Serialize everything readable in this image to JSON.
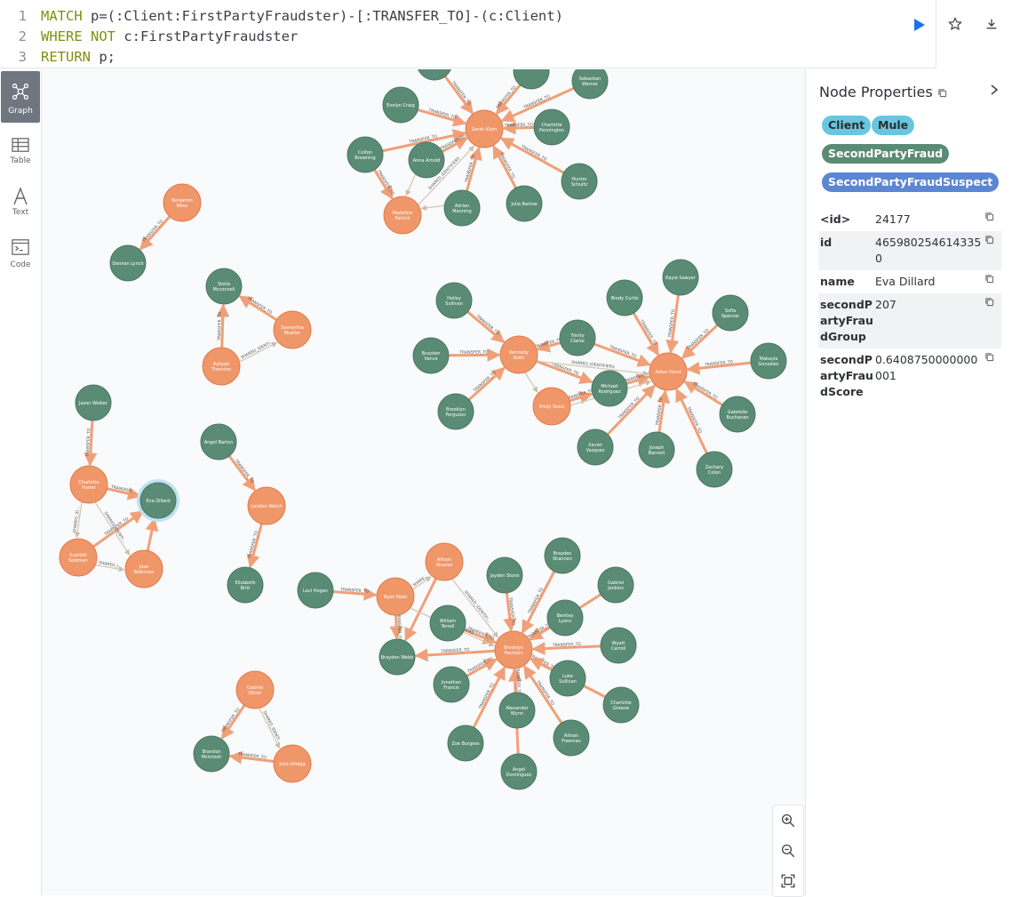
{
  "editor": {
    "lines": [
      {
        "num": "1",
        "parts": [
          {
            "t": "kw",
            "v": "MATCH"
          },
          {
            "t": "tx",
            "v": " p=(:Client:FirstPartyFraudster)-[:TRANSFER_TO]-(c:Client)"
          }
        ]
      },
      {
        "num": "2",
        "parts": [
          {
            "t": "kw",
            "v": "WHERE NOT"
          },
          {
            "t": "tx",
            "v": " c:FirstPartyFraudster"
          }
        ]
      },
      {
        "num": "3",
        "parts": [
          {
            "t": "kw",
            "v": "RETURN"
          },
          {
            "t": "tx",
            "v": " p;"
          }
        ]
      }
    ]
  },
  "toolbar_icons": [
    "play-icon",
    "star-icon",
    "download-icon"
  ],
  "sidebar": {
    "items": [
      {
        "label": "Graph",
        "icon": "graph-icon",
        "active": true
      },
      {
        "label": "Table",
        "icon": "table-icon",
        "active": false
      },
      {
        "label": "Text",
        "icon": "text-icon",
        "active": false
      },
      {
        "label": "Code",
        "icon": "code-icon",
        "active": false
      }
    ]
  },
  "panel": {
    "title": "Node Properties",
    "labels": [
      "Client",
      "Mule",
      "SecondPartyFraud",
      "SecondPartyFraudSuspect"
    ],
    "properties": [
      {
        "key": "<id>",
        "value": "24177"
      },
      {
        "key": "id",
        "value": "4659802546143350"
      },
      {
        "key": "name",
        "value": "Eva Dillard"
      },
      {
        "key": "secondPartyFraudGroup",
        "value": "207"
      },
      {
        "key": "secondPartyFraudScore",
        "value": "0.6408750000000001"
      }
    ]
  },
  "colors": {
    "fraudster": "#f0976a",
    "client": "#5a8c75",
    "edge": "#f0a078",
    "shared": "#d6c7b5"
  },
  "graph": {
    "nodes": [
      {
        "id": "sarah",
        "name": "Sarah Klein",
        "type": "f"
      },
      {
        "id": "madeline",
        "name": "Madeline Patrick",
        "type": "f"
      },
      {
        "id": "evelyn",
        "name": "Evelyn Craig",
        "type": "c"
      },
      {
        "id": "colton",
        "name": "Colton Browning",
        "type": "c"
      },
      {
        "id": "anna",
        "name": "Anna Arnold",
        "type": "c"
      },
      {
        "id": "adrian",
        "name": "Adrian Manning",
        "type": "c"
      },
      {
        "id": "juliab",
        "name": "Julia Barlow",
        "type": "c"
      },
      {
        "id": "hunter",
        "name": "Hunter Schultz",
        "type": "c"
      },
      {
        "id": "charlottep",
        "name": "Charlotte Pennington",
        "type": "c"
      },
      {
        "id": "sebastian",
        "name": "Sebastian Warner",
        "type": "c"
      },
      {
        "id": "top1",
        "name": "",
        "type": "c"
      },
      {
        "id": "top2",
        "name": "",
        "type": "c"
      },
      {
        "id": "benjamin",
        "name": "Benjamin Moss",
        "type": "f"
      },
      {
        "id": "damian",
        "name": "Damian Lynch",
        "type": "c"
      },
      {
        "id": "stella",
        "name": "Stella Mcconnell",
        "type": "c"
      },
      {
        "id": "samantha",
        "name": "Samantha Mueller",
        "type": "f"
      },
      {
        "id": "aaliyah",
        "name": "Aaliyah Thornton",
        "type": "f"
      },
      {
        "id": "jason",
        "name": "Jason Walker",
        "type": "c"
      },
      {
        "id": "charlottef",
        "name": "Charlotte Foster",
        "type": "f"
      },
      {
        "id": "eva",
        "name": "Eva Dillard",
        "type": "c",
        "selected": true
      },
      {
        "id": "scarlett",
        "name": "Scarlett Solomon",
        "type": "f"
      },
      {
        "id": "jose",
        "name": "Jose Robinson",
        "type": "f"
      },
      {
        "id": "angel",
        "name": "Angel Barton",
        "type": "c"
      },
      {
        "id": "landon",
        "name": "Landon Welch",
        "type": "f"
      },
      {
        "id": "elizabeth",
        "name": "Elizabeth Britt",
        "type": "c"
      },
      {
        "id": "gabriel",
        "name": "Gabriel Oliver",
        "type": "f"
      },
      {
        "id": "brandon",
        "name": "Brandon Mcintosh",
        "type": "c"
      },
      {
        "id": "juliao",
        "name": "Julia Ortega",
        "type": "f"
      },
      {
        "id": "hailey",
        "name": "Hailey Sullivan",
        "type": "c"
      },
      {
        "id": "brayden",
        "name": "Brayden Vance",
        "type": "c"
      },
      {
        "id": "kennedy",
        "name": "Kennedy Keith",
        "type": "f"
      },
      {
        "id": "brooklynf",
        "name": "Brooklyn Ferguson",
        "type": "c"
      },
      {
        "id": "trinity",
        "name": "Trinity Clarke",
        "type": "c"
      },
      {
        "id": "brody",
        "name": "Brody Curtis",
        "type": "c"
      },
      {
        "id": "kayla",
        "name": "Kayla Sawyer",
        "type": "c"
      },
      {
        "id": "sofia",
        "name": "Sofia Spencer",
        "type": "c"
      },
      {
        "id": "makayla",
        "name": "Makayla Gonzalez",
        "type": "c"
      },
      {
        "id": "aiden",
        "name": "Aiden Hurst",
        "type": "f"
      },
      {
        "id": "michael",
        "name": "Michael Rodriguez",
        "type": "c"
      },
      {
        "id": "emily",
        "name": "Emily Stout",
        "type": "f"
      },
      {
        "id": "gabriella",
        "name": "Gabriella Buchanan",
        "type": "c"
      },
      {
        "id": "xavier",
        "name": "Xavier Vasquez",
        "type": "c"
      },
      {
        "id": "joseph",
        "name": "Joseph Barnett",
        "type": "c"
      },
      {
        "id": "zachary",
        "name": "Zachary Colon",
        "type": "c"
      },
      {
        "id": "levi",
        "name": "Levi Hogan",
        "type": "c"
      },
      {
        "id": "ryan",
        "name": "Ryan Patel",
        "type": "f"
      },
      {
        "id": "allison",
        "name": "Allison Alvarez",
        "type": "f"
      },
      {
        "id": "william",
        "name": "William Terrell",
        "type": "c"
      },
      {
        "id": "braydenw",
        "name": "Brayden Webb",
        "type": "c"
      },
      {
        "id": "jayden",
        "name": "Jayden Stone",
        "type": "c"
      },
      {
        "id": "braydens",
        "name": "Brayden Shannon",
        "type": "c"
      },
      {
        "id": "gabrielj",
        "name": "Gabriel Jenkins",
        "type": "c"
      },
      {
        "id": "bentley",
        "name": "Bentley Lyons",
        "type": "c"
      },
      {
        "id": "wyatt",
        "name": "Wyatt Carroll",
        "type": "c"
      },
      {
        "id": "luke",
        "name": "Luke Sullivan",
        "type": "c"
      },
      {
        "id": "charlotteg",
        "name": "Charlotte Greene",
        "type": "c"
      },
      {
        "id": "allisonf",
        "name": "Allison Freeman",
        "type": "c"
      },
      {
        "id": "angeld",
        "name": "Angel Dominguez",
        "type": "c"
      },
      {
        "id": "alexander",
        "name": "Alexander Wynn",
        "type": "c"
      },
      {
        "id": "zoe",
        "name": "Zoe Burgess",
        "type": "c"
      },
      {
        "id": "jonathan",
        "name": "Jonathan Francis",
        "type": "c"
      },
      {
        "id": "brooklynh",
        "name": "Brooklyn Harrison",
        "type": "f"
      }
    ],
    "edges": [
      {
        "from": "evelyn",
        "to": "sarah",
        "label": "TRANSFER_TO"
      },
      {
        "from": "colton",
        "to": "sarah",
        "label": "TRANSFER_TO"
      },
      {
        "from": "anna",
        "to": "sarah",
        "label": "TRANSFER_TO"
      },
      {
        "from": "adrian",
        "to": "sarah",
        "label": "TRANSFER_TO"
      },
      {
        "from": "juliab",
        "to": "sarah",
        "label": "TRANSFER_TO"
      },
      {
        "from": "hunter",
        "to": "sarah",
        "label": "TRANSFER_TO"
      },
      {
        "from": "charlottep",
        "to": "sarah",
        "label": "TRANSFER_TO"
      },
      {
        "from": "sebastian",
        "to": "sarah",
        "label": "TRANSFER_TO"
      },
      {
        "from": "top1",
        "to": "sarah",
        "label": "TRANSFER_TO"
      },
      {
        "from": "top2",
        "to": "sarah",
        "label": "TRANSFER_TO"
      },
      {
        "from": "colton",
        "to": "madeline",
        "label": "TRANSFER_TO"
      },
      {
        "from": "madeline",
        "to": "sarah",
        "label": "SHARED_IDENTIFIERS",
        "shared": true
      },
      {
        "from": "anna",
        "to": "madeline",
        "label": "",
        "shared": true
      },
      {
        "from": "adrian",
        "to": "madeline",
        "label": "",
        "shared": true
      },
      {
        "from": "benjamin",
        "to": "damian",
        "label": "TRANSFER_TO"
      },
      {
        "from": "samantha",
        "to": "stella",
        "label": "TRANSFER_TO"
      },
      {
        "from": "aaliyah",
        "to": "stella",
        "label": "TRANSFER_TO"
      },
      {
        "from": "aaliyah",
        "to": "samantha",
        "label": "SHARED_IDENTI...",
        "shared": true
      },
      {
        "from": "jason",
        "to": "charlottef",
        "label": "TRANSFER_TO"
      },
      {
        "from": "charlottef",
        "to": "eva",
        "label": "TRANSFER_..."
      },
      {
        "from": "jose",
        "to": "eva",
        "label": ""
      },
      {
        "from": "scarlett",
        "to": "eva",
        "label": "TRANSFER_TO"
      },
      {
        "from": "charlottef",
        "to": "scarlett",
        "label": "SHARED_ID...",
        "shared": true
      },
      {
        "from": "charlottef",
        "to": "jose",
        "label": "SHARED_IDENTI...",
        "shared": true
      },
      {
        "from": "scarlett",
        "to": "jose",
        "label": "SHARED_I...",
        "shared": true
      },
      {
        "from": "angel",
        "to": "landon",
        "label": "TRANSFER_TO"
      },
      {
        "from": "landon",
        "to": "elizabeth",
        "label": "TRANSFER_TO"
      },
      {
        "from": "gabriel",
        "to": "brandon",
        "label": "TRANSFER_TO"
      },
      {
        "from": "juliao",
        "to": "brandon",
        "label": "TRANSFER_TO"
      },
      {
        "from": "gabriel",
        "to": "juliao",
        "label": "SHARED_IDENTI...",
        "shared": true
      },
      {
        "from": "hailey",
        "to": "kennedy",
        "label": "TRANSFER_TO"
      },
      {
        "from": "brayden",
        "to": "kennedy",
        "label": "TRANSFER_TO"
      },
      {
        "from": "brooklynf",
        "to": "kennedy",
        "label": "TRANSFER_TO"
      },
      {
        "from": "trinity",
        "to": "kennedy",
        "label": "TRANSFER_TO"
      },
      {
        "from": "brody",
        "to": "aiden",
        "label": "TRANSFER_TO"
      },
      {
        "from": "kayla",
        "to": "aiden",
        "label": "TRANSFER_TO"
      },
      {
        "from": "sofia",
        "to": "aiden",
        "label": "TRANSFER_TO"
      },
      {
        "from": "makayla",
        "to": "aiden",
        "label": "TRANSFER_TO"
      },
      {
        "from": "gabriella",
        "to": "aiden",
        "label": "TRANSFER_TO"
      },
      {
        "from": "xavier",
        "to": "aiden",
        "label": "TRANSFER_TO"
      },
      {
        "from": "joseph",
        "to": "aiden",
        "label": "TRANSFER_TO"
      },
      {
        "from": "zachary",
        "to": "aiden",
        "label": "TRANSFER_TO"
      },
      {
        "from": "trinity",
        "to": "aiden",
        "label": "TRANSFER_TO"
      },
      {
        "from": "michael",
        "to": "aiden",
        "label": "TRANSFER_TO"
      },
      {
        "from": "kennedy",
        "to": "michael",
        "label": "TRANSFER_TO"
      },
      {
        "from": "emily",
        "to": "michael",
        "label": "TRANSFER_TO"
      },
      {
        "from": "kennedy",
        "to": "aiden",
        "label": "SHARED_IDENTIFIERS",
        "shared": true
      },
      {
        "from": "kennedy",
        "to": "emily",
        "label": "",
        "shared": true
      },
      {
        "from": "emily",
        "to": "aiden",
        "label": "",
        "shared": true
      },
      {
        "from": "levi",
        "to": "ryan",
        "label": "TRANSFER_TO"
      },
      {
        "from": "ryan",
        "to": "braydenw",
        "label": "TRANSFER_TO"
      },
      {
        "from": "allison",
        "to": "braydenw",
        "label": ""
      },
      {
        "from": "william",
        "to": "brooklynh",
        "label": "TRANSFER_TO"
      },
      {
        "from": "brooklynh",
        "to": "braydenw",
        "label": "TRANSFER_TO"
      },
      {
        "from": "jayden",
        "to": "brooklynh",
        "label": "TRANSFER_TO"
      },
      {
        "from": "braydens",
        "to": "brooklynh",
        "label": "TRANSFER_TO"
      },
      {
        "from": "gabrielj",
        "to": "brooklynh",
        "label": "TRANSFER_TO"
      },
      {
        "from": "bentley",
        "to": "brooklynh",
        "label": "TRANSFER_TO"
      },
      {
        "from": "wyatt",
        "to": "brooklynh",
        "label": "TRANSFER_TO"
      },
      {
        "from": "luke",
        "to": "brooklynh",
        "label": "TRANSFER_TO"
      },
      {
        "from": "charlotteg",
        "to": "brooklynh",
        "label": "TRANSFER_TO"
      },
      {
        "from": "allisonf",
        "to": "brooklynh",
        "label": "TRANSFER_TO"
      },
      {
        "from": "angeld",
        "to": "brooklynh",
        "label": "TRANSFER_TO"
      },
      {
        "from": "alexander",
        "to": "brooklynh",
        "label": "TRANSFER_TO"
      },
      {
        "from": "zoe",
        "to": "brooklynh",
        "label": "TRANSFER_TO"
      },
      {
        "from": "jonathan",
        "to": "brooklynh",
        "label": "TRANSFER_TO"
      },
      {
        "from": "ryan",
        "to": "allison",
        "label": "SHARE...",
        "shared": true
      },
      {
        "from": "ryan",
        "to": "brooklynh",
        "label": "SHARED_IDENTIFIERS",
        "shared": true
      },
      {
        "from": "allison",
        "to": "brooklynh",
        "label": "SHARED_IDENTIFI...",
        "shared": true
      }
    ]
  }
}
